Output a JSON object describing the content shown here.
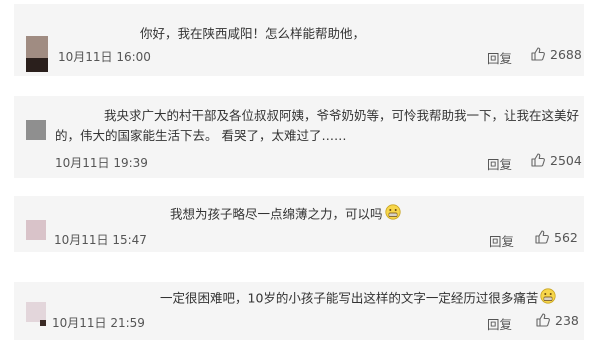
{
  "comments": [
    {
      "text": "你好，我在陕西咸阳！怎么样能帮助他，",
      "time": "10月11日 16:00",
      "reply": "回复",
      "likes": "2688",
      "avatar_colors": [
        "#a08c82",
        "#2a1f1c"
      ]
    },
    {
      "text_line1": "我央求广大的村干部及各位叔叔阿姨，爷爷奶奶等，可怜我帮助我一下，让我在这美好",
      "text_line2": "的，伟大的国家能生活下去。 看哭了，太难过了……",
      "time": "10月11日 19:39",
      "reply": "回复",
      "likes": "2504",
      "avatar_colors": [
        "#8f8f8f"
      ]
    },
    {
      "text": "我想为孩子略尽一点绵薄之力，可以吗",
      "time": "10月11日 15:47",
      "reply": "回复",
      "likes": "562",
      "avatar_colors": [
        "#d9c3c9"
      ]
    },
    {
      "text": "一定很困难吧，10岁的小孩子能写出这样的文字一定经历过很多痛苦",
      "time": "10月11日 21:59",
      "reply": "回复",
      "likes": "238",
      "avatar_colors": [
        "#e3d6db",
        "#3b2a25"
      ]
    }
  ],
  "colors": {
    "card_bg": "#f5f5f5",
    "text": "#333333",
    "meta": "#555555"
  },
  "icons": [
    "thumbs-up-icon",
    "grimace-emoji-icon"
  ]
}
